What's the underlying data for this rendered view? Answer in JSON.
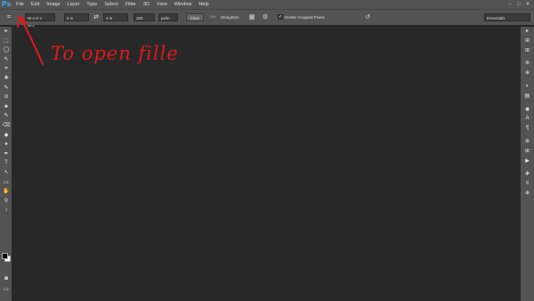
{
  "app": {
    "logo": "Ps"
  },
  "menu": [
    "File",
    "Edit",
    "Image",
    "Layer",
    "Type",
    "Select",
    "Filter",
    "3D",
    "View",
    "Window",
    "Help"
  ],
  "window_controls": {
    "minimize": "–",
    "maximize": "□",
    "close": "✕"
  },
  "options": {
    "ratio_select": "W x H x Res...",
    "width_value": "5 in",
    "height_value": "4 in",
    "resolution_value": "300",
    "resolution_unit": "px/in",
    "clear_label": "Clear",
    "straighten_prefix": "Stdt",
    "straighten_label": "Straighten",
    "delete_cropped_label": "Delete Cropped Pixels",
    "delete_cropped_checked": "✓",
    "workspace_select": "Essentials"
  },
  "annotation": {
    "text": "To open fille",
    "color": "#e01a1a"
  },
  "icons": {
    "crop": "⌗",
    "swap": "⇄",
    "grid": "▦",
    "gear": "⚙",
    "reset": "↺",
    "tools": [
      "▸",
      "⬚",
      "◯",
      "✎",
      "⌗",
      "✚",
      "✎",
      "⊙",
      "♣",
      "✎",
      "⌫",
      "◆",
      "●",
      "✒",
      "T",
      "↖",
      "▭",
      "✋",
      "⚲",
      "↕"
    ],
    "panel": [
      "▸",
      "⊞",
      "⊞",
      "⊛",
      "⊕",
      "◐",
      "▤",
      "◉",
      "A",
      "¶",
      "⊛",
      "⊞",
      "▶",
      "◈",
      "≡",
      "⊕"
    ],
    "quickmask": "◙",
    "screen_mode": "▭"
  },
  "colors": {
    "chrome": "#535353",
    "canvas": "#282828",
    "accent": "#3fa4f0"
  }
}
